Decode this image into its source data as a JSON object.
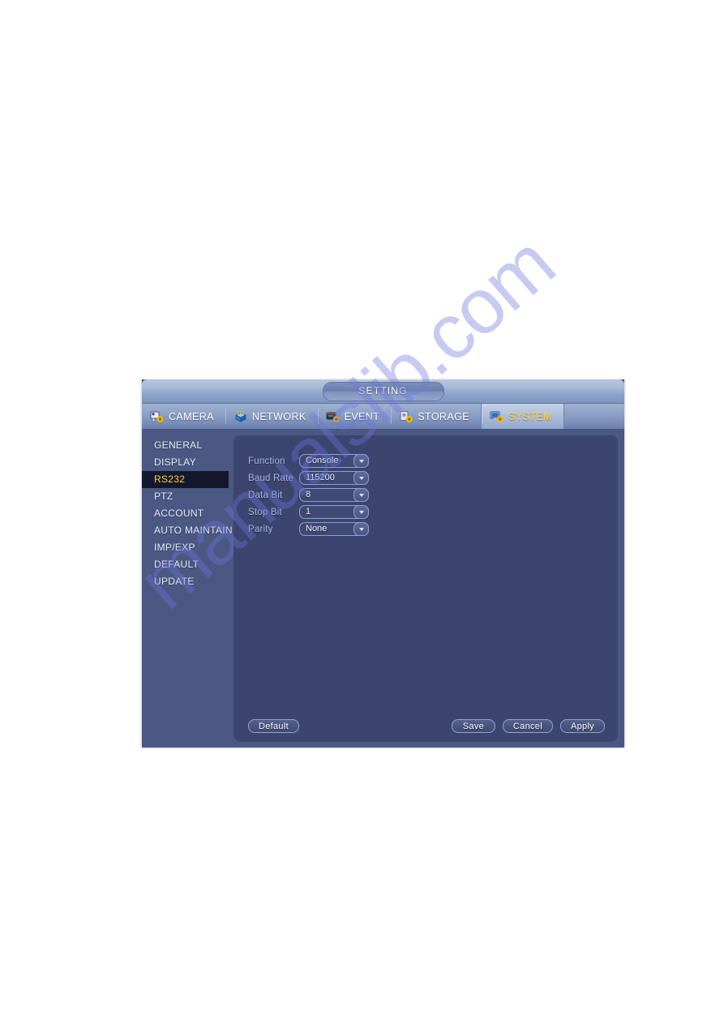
{
  "page": {
    "watermark_text": "manualslib.com"
  },
  "dialog": {
    "title": "SETTING",
    "tabs": [
      {
        "label": "CAMERA",
        "icon": "camera-gear-icon",
        "selected": false
      },
      {
        "label": "NETWORK",
        "icon": "network-cube-icon",
        "selected": false
      },
      {
        "label": "EVENT",
        "icon": "event-gear-icon",
        "selected": false
      },
      {
        "label": "STORAGE",
        "icon": "storage-gear-icon",
        "selected": false
      },
      {
        "label": "SYSTEM",
        "icon": "system-monitor-gear-icon",
        "selected": true
      }
    ],
    "sidebar": {
      "items": [
        {
          "label": "GENERAL",
          "selected": false
        },
        {
          "label": "DISPLAY",
          "selected": false
        },
        {
          "label": "RS232",
          "selected": true
        },
        {
          "label": "PTZ",
          "selected": false
        },
        {
          "label": "ACCOUNT",
          "selected": false
        },
        {
          "label": "AUTO MAINTAIN",
          "selected": false
        },
        {
          "label": "IMP/EXP",
          "selected": false
        },
        {
          "label": "DEFAULT",
          "selected": false
        },
        {
          "label": "UPDATE",
          "selected": false
        }
      ]
    },
    "form": {
      "fields": [
        {
          "label": "Function",
          "value": "Console"
        },
        {
          "label": "Baud Rate",
          "value": "115200"
        },
        {
          "label": "Data Bit",
          "value": "8"
        },
        {
          "label": "Stop Bit",
          "value": "1"
        },
        {
          "label": "Parity",
          "value": "None"
        }
      ]
    },
    "buttons": {
      "default_label": "Default",
      "save_label": "Save",
      "cancel_label": "Cancel",
      "apply_label": "Apply"
    },
    "colors": {
      "accent_selected_text": "#ffd23c",
      "dialog_body": "#4b5883",
      "content_panel": "#3b456e",
      "sidebar_selected_bg": "#14182c",
      "label_text": "#aab9ea"
    }
  }
}
